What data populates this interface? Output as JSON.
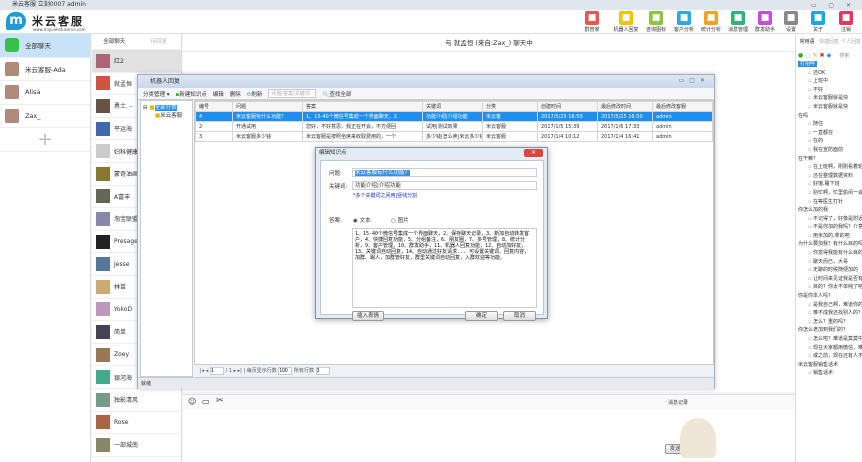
{
  "app": {
    "title": "米云客服  立刻0007 admin",
    "brand": "米云客服",
    "url": "www.miyunkefuserve.com",
    "logo_letter": "m"
  },
  "toolbar": [
    {
      "label": "群管家",
      "icon": "briefcase-icon",
      "color": "#e8584a"
    },
    {
      "label": "机器人回复",
      "icon": "robot-icon",
      "color": "#f5c400"
    },
    {
      "label": "咨询图标",
      "icon": "cursor-icon",
      "color": "#8cc63f"
    },
    {
      "label": "客户分析",
      "icon": "user-icon",
      "color": "#2ea8e0"
    },
    {
      "label": "统计分析",
      "icon": "clock-icon",
      "color": "#f7a021"
    },
    {
      "label": "消息管理",
      "icon": "chat-icon",
      "color": "#2bb673"
    },
    {
      "label": "群发助手",
      "icon": "flag-icon",
      "color": "#c44ed8"
    },
    {
      "label": "设置",
      "icon": "gear-icon",
      "color": "#888888"
    },
    {
      "label": "关于",
      "icon": "info-icon",
      "color": "#1aa7e6"
    },
    {
      "label": "注销",
      "icon": "close-icon",
      "color": "#e8365d"
    }
  ],
  "sidebar": [
    {
      "label": "全部聊天",
      "active": true
    },
    {
      "label": "米云客服-Ada"
    },
    {
      "label": "Alisa"
    },
    {
      "label": "Zax_"
    }
  ],
  "contacts": {
    "tabs": [
      "全部聊天",
      "待回复"
    ],
    "items": [
      "红2",
      "就孟恒",
      "勇士. -",
      "平运海",
      "妇科健康",
      "蒙奇油画",
      "A富丰",
      "淘宝联盟",
      "Presage",
      "Jesse",
      "林苗",
      "YokoD",
      "简单",
      "Zoey",
      "银河海",
      "独影清风",
      "Rose",
      "一部城南"
    ]
  },
  "chat": {
    "header": "与 就孟恒 (来自:Zax_) 聊天中",
    "history_label": "消息记录",
    "send_label": "发送(S)"
  },
  "right": {
    "tabs": [
      "常用语",
      "快捷回复",
      "个人回复"
    ],
    "search_placeholder": "搜索",
    "groups": [
      {
        "name": "打招呼",
        "selected": true,
        "items": [
          "还OK",
          "上班中",
          "不好",
          "米云客服就是快",
          "米云客服就是快"
        ]
      },
      {
        "name": "在吗",
        "items": [
          "随住",
          "一直都在",
          "在的",
          "我在宣防面前"
        ]
      },
      {
        "name": "在干嘛？",
        "items": [
          "在上班啊，刚刚看着轮询号",
          "还在整理数据资料",
          "好饿,睡下班",
          "别忙啊，忙里偷闲一会会",
          "在等医生打针"
        ]
      },
      {
        "name": "你怎么加的我",
        "items": [
          "不记得了，好像是附近的人吧",
          "不是你加的我吗？介意成为好友吗？",
          "用米加的,拿的吧"
        ]
      },
      {
        "name": "为什么要加我？有什么目的吗",
        "items": [
          "你觉得我能有什么目的呢？",
          "聊天而已，大哥",
          "无聊的时候随便加的",
          "让时间来见证我是否有目的",
          "目的？你太不单纯了吧？"
        ]
      },
      {
        "name": "你是你本人吗？",
        "items": [
          "是我自己啊，难道你的不是？",
          "难不成我还找别人的？不会这么无聊",
          "怎么？重的吗？"
        ]
      },
      {
        "name": "你怎么老加到我们的？",
        "items": [
          "怎么啦？难道是莫莫中注定的缘分？",
          "现在大家都用微信，难免你也会加到我们同事",
          "或之前，现在还有人不用微信？"
        ]
      },
      {
        "name": "米云客服销售话术",
        "items": [
          "销售话术"
        ]
      }
    ]
  },
  "robot": {
    "title": "机器人回复",
    "toolbar": {
      "category": "分类管理",
      "new": "新建知识点",
      "edit": "编辑",
      "delete": "删除",
      "refresh": "刷新",
      "search_placeholder": "问题/答案/关键词",
      "find_all": "查找全部"
    },
    "tree": {
      "root": "全部分类",
      "child": "米云客服"
    },
    "columns": [
      "编号",
      "问题",
      "答案",
      "关键词",
      "分类",
      "创建时间",
      "最后修改时间",
      "最后修改客服"
    ],
    "rows": [
      [
        "4",
        "米云客服有什么功能？",
        "1、15-40个微信号集成一个界面聊天，2",
        "功能介绍|介绍功能",
        "米云客",
        "2017/5/25 16:50",
        "2017/5/25 16:50",
        "admin"
      ],
      [
        "2",
        "开通试用",
        "您好，不好意思，我正在开会，不方便回",
        "试用|测试效果",
        "米云客服",
        "2017/1/5 15:39",
        "2017/1/6 17:33",
        "admin"
      ],
      [
        "3",
        "米云客服多少钱",
        "米云客服是按照坐席来收取费用的，一个",
        "多少钱|怎么卖|米云多少钱",
        "米云客服",
        "2017/1/4 10:12",
        "2017/1/4 16:41",
        "admin"
      ]
    ],
    "selected_row": 0,
    "pager": {
      "page": "1",
      "total": "/ 1",
      "page_size_label": "每页显示行数",
      "page_size": "100",
      "total_rows_label": "所有行数",
      "total_rows": "3"
    },
    "status": "就绪"
  },
  "dialog": {
    "title": "编辑知识点",
    "question_label": "问题:",
    "question": "米云客服有什么功能？",
    "keyword_label": "关键词:",
    "keyword": "功能介绍|介绍功能",
    "keyword_hint": "*多个关键词之间用|竖线分割",
    "answer_label": "答案:",
    "radio_text": "文本",
    "radio_image": "图片",
    "answer_type": "文本",
    "answer": "1、15-40个微信号集成一个界面聊天，2、保存聊天记录，3、新加自动转发客户，4、快捷回复功能，5、分组备注，6、朋友圈，7、多号管理，8、统计分析，9、客户管理，10、群发助手，11、机器人回复功能，12、自动加好友，13、关键词自动回复，14、自动通过好友请求... 可设置关键词、回复内容，加群、踢人，加群管好友，群里关键词自动回复，入群欢迎等功能。",
    "insert_emoji": "插入表情",
    "ok": "确定",
    "cancel": "取消"
  }
}
